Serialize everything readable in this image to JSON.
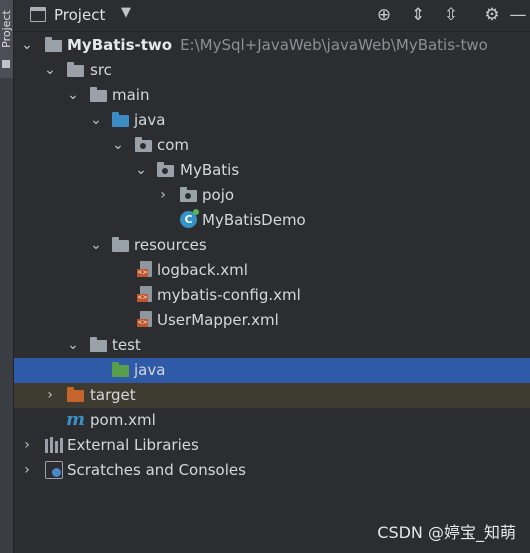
{
  "side": {
    "tab_label": "Project"
  },
  "toolbar": {
    "title": "Project",
    "dropdown_icon": "chevron-down-icon",
    "icons": [
      "locate-icon",
      "expand-all-icon",
      "collapse-all-icon",
      "gear-icon",
      "hide-icon"
    ]
  },
  "tree": {
    "root": {
      "name": "MyBatis-two",
      "path": "E:\\MySql+JavaWeb\\javaWeb\\MyBatis-two"
    },
    "src": "src",
    "main": "main",
    "java": "java",
    "com": "com",
    "mybatis": "MyBatis",
    "pojo": "pojo",
    "demo": "MyBatisDemo",
    "resources": "resources",
    "files": [
      "logback.xml",
      "mybatis-config.xml",
      "UserMapper.xml"
    ],
    "test": "test",
    "test_java": "java",
    "target": "target",
    "pom": "pom.xml",
    "libraries": "External Libraries",
    "scratches": "Scratches and Consoles"
  },
  "watermark": "CSDN @婷宝_知萌",
  "colors": {
    "selected_row": "#2e5aa7",
    "excluded_row": "#3e3b31",
    "source_folder": "#3b8cc2",
    "test_folder": "#5a9e4b",
    "excluded_folder": "#c5652c"
  }
}
